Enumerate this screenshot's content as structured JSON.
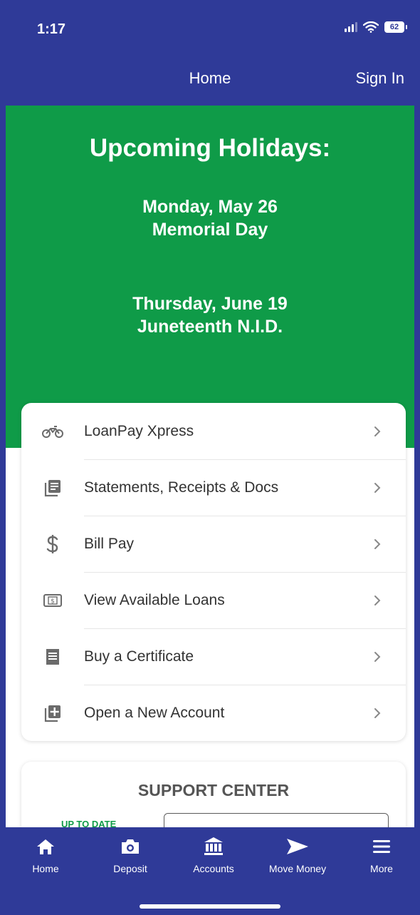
{
  "status_bar": {
    "time": "1:17",
    "battery": "62"
  },
  "header": {
    "title": "Home",
    "sign_in": "Sign In"
  },
  "banner": {
    "title": "Upcoming Holidays:",
    "holidays": [
      {
        "date": "Monday, May 26",
        "name": "Memorial Day"
      },
      {
        "date": "Thursday, June 19",
        "name": "Juneteenth N.I.D."
      }
    ]
  },
  "menu": {
    "items": [
      {
        "label": "LoanPay Xpress",
        "icon": "motorcycle-icon"
      },
      {
        "label": "Statements, Receipts & Docs",
        "icon": "documents-icon"
      },
      {
        "label": "Bill Pay",
        "icon": "dollar-icon"
      },
      {
        "label": "View Available Loans",
        "icon": "money-bill-icon"
      },
      {
        "label": "Buy a Certificate",
        "icon": "certificate-icon"
      },
      {
        "label": "Open a New Account",
        "icon": "add-account-icon"
      }
    ]
  },
  "support": {
    "title": "SUPPORT CENTER",
    "green_text": "UP TO DATE"
  },
  "tabs": [
    {
      "label": "Home",
      "icon": "home-icon"
    },
    {
      "label": "Deposit",
      "icon": "camera-icon"
    },
    {
      "label": "Accounts",
      "icon": "bank-icon"
    },
    {
      "label": "Move Money",
      "icon": "send-icon"
    },
    {
      "label": "More",
      "icon": "menu-icon"
    }
  ],
  "colors": {
    "primary_blue": "#2f3a98",
    "banner_green": "#0f9b48",
    "text_dark": "#333333",
    "icon_gray": "#6b6b6b"
  }
}
